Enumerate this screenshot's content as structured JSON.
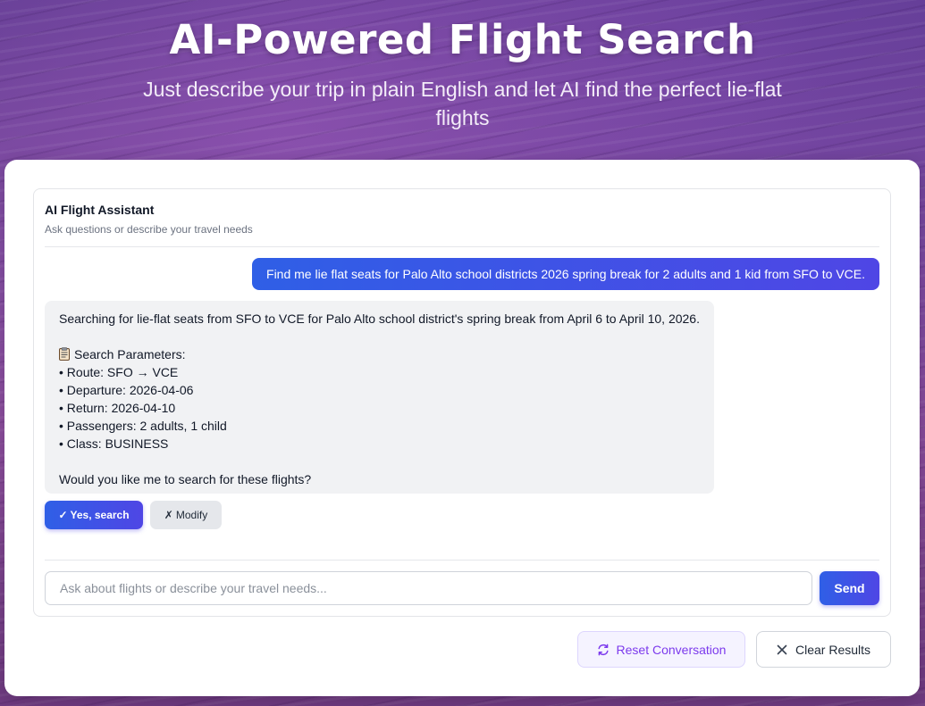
{
  "hero": {
    "title": "AI-Powered Flight Search",
    "subtitle": "Just describe your trip in plain English and let AI find the perfect lie-flat flights"
  },
  "assistant": {
    "title": "AI Flight Assistant",
    "description": "Ask questions or describe your travel needs"
  },
  "messages": {
    "user": "Find me lie flat seats for Palo Alto school districts 2026 spring break for 2 adults and 1 kid from SFO to VCE.",
    "ai": {
      "intro": "Searching for lie-flat seats from SFO to VCE for Palo Alto school district's spring break from April 6 to April 10, 2026.",
      "params_heading": "Search Parameters:",
      "params_icon": "clipboard-icon",
      "params": [
        "• Route: SFO → VCE",
        "• Departure: 2026-04-06",
        "• Return: 2026-04-10",
        "• Passengers: 2 adults, 1 child",
        "• Class: BUSINESS"
      ],
      "question": "Would you like me to search for these flights?"
    }
  },
  "actions": {
    "yes_label": "Yes, search",
    "yes_icon_glyph": "✓",
    "modify_label": "Modify",
    "modify_icon_glyph": "✗"
  },
  "input": {
    "placeholder": "Ask about flights or describe your travel needs...",
    "value": "",
    "send_label": "Send"
  },
  "footer": {
    "reset_label": "Reset Conversation",
    "reset_icon": "refresh-icon",
    "clear_label": "Clear Results",
    "clear_icon": "close-icon"
  },
  "colors": {
    "accent_blue": "#2f5fe6",
    "accent_indigo": "#4f46e5",
    "reset_purple": "#7c3aed"
  }
}
